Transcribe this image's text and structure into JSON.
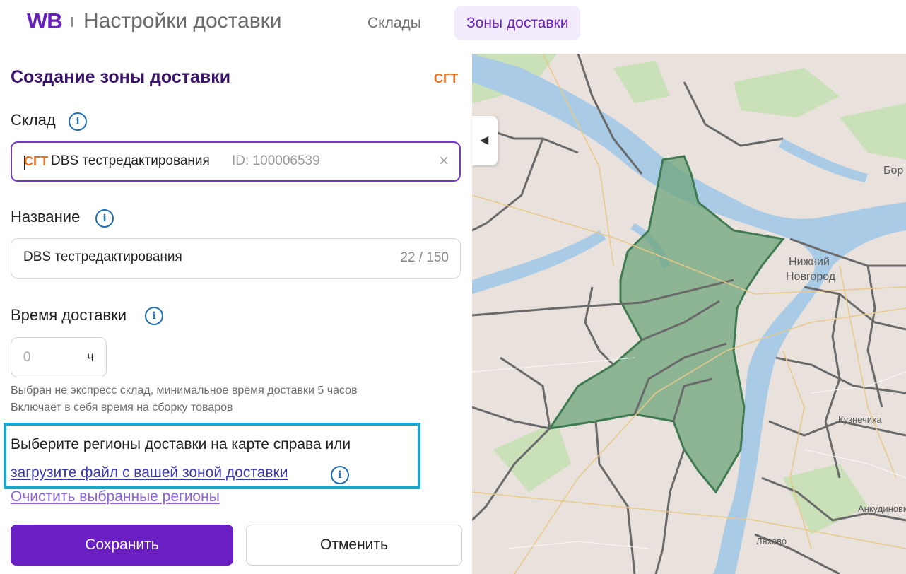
{
  "header": {
    "logo": "WB",
    "title": "Настройки доставки",
    "tabs": [
      {
        "label": "Склады",
        "active": false
      },
      {
        "label": "Зоны доставки",
        "active": true
      }
    ]
  },
  "form": {
    "title": "Создание зоны доставки",
    "tag": "СГТ",
    "warehouse": {
      "label": "Склад",
      "tag": "СГТ",
      "value": "DBS тестредактирования",
      "id_text": "ID: 100006539",
      "clear_icon": "×"
    },
    "name": {
      "label": "Название",
      "value": "DBS тестредактирования",
      "counter": "22 / 150"
    },
    "delivery_time": {
      "label": "Время доставки",
      "value": "0",
      "unit": "ч",
      "hint_1": "Выбран не экспресс склад, минимальное время доставки 5 часов",
      "hint_2": "Включает в себя время на сборку товаров"
    },
    "regions": {
      "text": "Выберите регионы доставки на карте справа или",
      "upload_link": "загрузите файл с вашей зоной доставки",
      "clear_link": "Очистить выбранные регионы"
    },
    "buttons": {
      "save": "Сохранить",
      "cancel": "Отменить"
    }
  },
  "map": {
    "labels": {
      "city_line1": "Нижний",
      "city_line2": "Новгород",
      "bor": "Бор",
      "kuznechikha": "Кузнечиха",
      "ankudinovka": "Анкудиновка",
      "lyakhovo": "Ляхово"
    },
    "colors": {
      "land": "#e8e1dc",
      "water": "#a9cbe6",
      "park": "#c5dfb5",
      "selected_zone": "#6fa57c",
      "border": "#6e6e6e"
    }
  },
  "icons": [
    "info-icon",
    "clear-icon",
    "chevron-left-icon"
  ]
}
